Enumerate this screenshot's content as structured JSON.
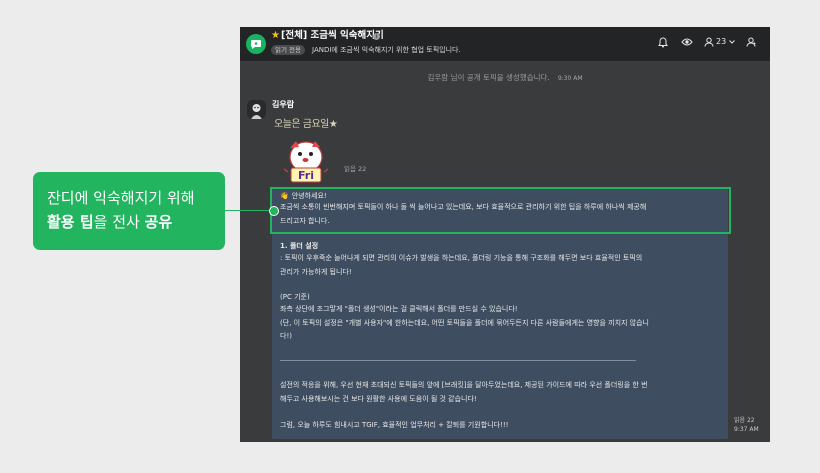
{
  "header": {
    "title": "[전체] 조금씩 익숙해지기",
    "readonly_badge": "읽기 전용",
    "description": "JANDI에 조금씩 익숙해지기 위한 협업 토픽입니다.",
    "member_count": "23",
    "icons": [
      "topic-icon",
      "star-icon",
      "info-icon",
      "bell-icon",
      "eye-icon",
      "members-icon",
      "chevron-down-icon",
      "profile-icon"
    ]
  },
  "system_message": {
    "text": "김우람 님이 공개 토픽을 생성했습니다.",
    "time": "9:30 AM"
  },
  "message": {
    "sender": "김우람",
    "sticker_caption": "오늘은 금요일★",
    "sticker_text": "Fri",
    "sticker_unread": "읽음 22",
    "card_lines": [
      "안녕하세요!",
      "조금씩 소통이 빈번해지며 토픽들이 하나 둘 씩 늘어나고 있는데요, 보다 효율적으로 관리하기 위한 팁을 하루에 하나씩 제공해",
      "드리고자 합니다.",
      "1. 폴더 설정",
      ": 토픽이 우후죽순 늘어나게 되면 관리의 이슈가 발생을 하는데요, 폴더링 기능을 통해 구조화를 해두면 보다 효율적인 토픽의",
      "관리가 가능하게 됩니다!",
      "(PC 기준)",
      "좌측 상단에 조그맣게 \"폴더 생성\"이라는 걸 클릭해서 폴더를 만드실 수 있습니다!",
      "(단, 이 토픽의 설정은 \"개별 사용자\"에 한하는데요, 어떤 토픽들을 폴더에 묶어두든지 다른 사람들에게는 영향을 끼치지 않습니",
      "다!)",
      "설전의 적응을 위해, 우선 현재 초대되신 토픽들의 앞에 [브래킷]을 달아두었는데요, 제공된 가이드에 따라 우선 폴더링을 한 번",
      "해두고 사용해보시는 건 보다 원활한 사용에 도움이 될 것 같습니다!",
      "그럼, 오늘 하루도 힘내시고 TGIF, 효율적인 업무처리 + 칼퇴를 기원합니다!!!"
    ],
    "unread": "읽음 22",
    "time": "9:37 AM"
  },
  "callout": {
    "line1": "잔디에 익숙해지기 위해",
    "line2_bold_a": "활용 팁",
    "line2_mid": "을 전사 ",
    "line2_bold_b": "공유"
  },
  "colors": {
    "accent": "#22b45e",
    "panel_bg": "#3a3b3d",
    "header_bg": "#232426",
    "card_bg": "#3e4d60"
  }
}
